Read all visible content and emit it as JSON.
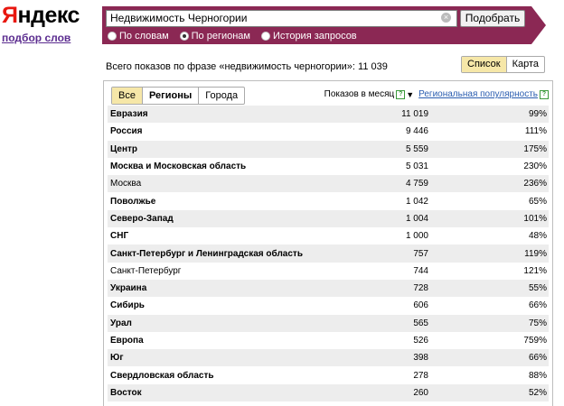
{
  "logo": {
    "first_letter": "Я",
    "rest": "ндекс"
  },
  "sub_link": "подбор слов",
  "search": {
    "query": "Недвижимость Черногории",
    "button": "Подобрать",
    "radios": [
      {
        "label": "По словам",
        "selected": false
      },
      {
        "label": "По регионам",
        "selected": true
      },
      {
        "label": "История запросов",
        "selected": false
      }
    ]
  },
  "summary": {
    "text": "Всего показов по фразе «недвижимость черногории»: 11 039"
  },
  "view_toggle": {
    "list": "Список",
    "map": "Карта"
  },
  "tabs": {
    "all": "Все",
    "regions": "Регионы",
    "cities": "Города"
  },
  "columns": {
    "shows": "Показов в месяц",
    "popularity": "Региональная популярность"
  },
  "rows": [
    {
      "name": "Евразия",
      "shows": "11 019",
      "pop": "99%",
      "bold": true
    },
    {
      "name": "Россия",
      "shows": "9 446",
      "pop": "111%",
      "bold": true
    },
    {
      "name": "Центр",
      "shows": "5 559",
      "pop": "175%",
      "bold": true
    },
    {
      "name": "Москва и Московская область",
      "shows": "5 031",
      "pop": "230%",
      "bold": true
    },
    {
      "name": "Москва",
      "shows": "4 759",
      "pop": "236%",
      "bold": false
    },
    {
      "name": "Поволжье",
      "shows": "1 042",
      "pop": "65%",
      "bold": true
    },
    {
      "name": "Северо-Запад",
      "shows": "1 004",
      "pop": "101%",
      "bold": true
    },
    {
      "name": "СНГ",
      "shows": "1 000",
      "pop": "48%",
      "bold": true
    },
    {
      "name": "Санкт-Петербург и Ленинградская область",
      "shows": "757",
      "pop": "119%",
      "bold": true
    },
    {
      "name": "Санкт-Петербург",
      "shows": "744",
      "pop": "121%",
      "bold": false
    },
    {
      "name": "Украина",
      "shows": "728",
      "pop": "55%",
      "bold": true
    },
    {
      "name": "Сибирь",
      "shows": "606",
      "pop": "66%",
      "bold": true
    },
    {
      "name": "Урал",
      "shows": "565",
      "pop": "75%",
      "bold": true
    },
    {
      "name": "Европа",
      "shows": "526",
      "pop": "759%",
      "bold": true
    },
    {
      "name": "Юг",
      "shows": "398",
      "pop": "66%",
      "bold": true
    },
    {
      "name": "Свердловская область",
      "shows": "278",
      "pop": "88%",
      "bold": true
    },
    {
      "name": "Восток",
      "shows": "260",
      "pop": "52%",
      "bold": true
    }
  ]
}
